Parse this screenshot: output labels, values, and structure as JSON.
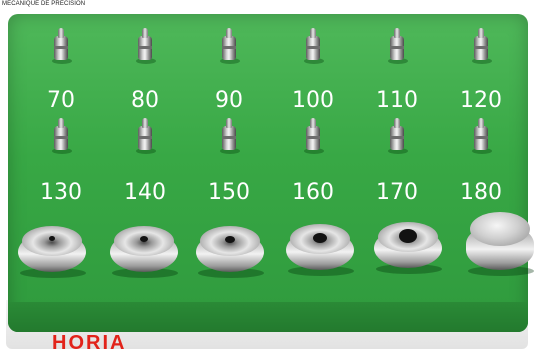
{
  "caption": "MECANIQUE DE PRECISION",
  "brand": "HORIA",
  "rows": [
    {
      "numbers": [
        "70",
        "80",
        "90",
        "100",
        "110",
        "120"
      ]
    },
    {
      "numbers": [
        "130",
        "140",
        "150",
        "160",
        "170",
        "180"
      ]
    }
  ],
  "colors": {
    "block": "#38a845",
    "numbers": "#ffffff",
    "brand": "#e2231a"
  }
}
